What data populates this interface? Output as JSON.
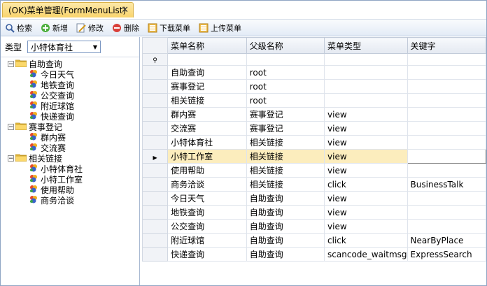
{
  "window": {
    "tab_title": "(OK)菜单管理(FormMenuList)",
    "close_glyph": "✕"
  },
  "toolbar": [
    {
      "label": "检索",
      "icon": "search-icon"
    },
    {
      "label": "新增",
      "icon": "add-icon"
    },
    {
      "label": "修改",
      "icon": "edit-icon"
    },
    {
      "label": "删除",
      "icon": "delete-icon"
    },
    {
      "label": "下载菜单",
      "icon": "download-menu-icon"
    },
    {
      "label": "上传菜单",
      "icon": "upload-menu-icon"
    }
  ],
  "filter": {
    "label": "类型",
    "selected": "小特体育社"
  },
  "tree": [
    {
      "label": "自助查询",
      "expanded": true,
      "children": [
        "今日天气",
        "地铁查询",
        "公交查询",
        "附近球馆",
        "快递查询"
      ]
    },
    {
      "label": "赛事登记",
      "expanded": true,
      "children": [
        "群内赛",
        "交流赛"
      ]
    },
    {
      "label": "相关链接",
      "expanded": true,
      "children": [
        "小特体育社",
        "小特工作室",
        "使用帮助",
        "商务洽谈"
      ]
    }
  ],
  "grid": {
    "columns": [
      "菜单名称",
      "父级名称",
      "菜单类型",
      "关键字"
    ],
    "selected_row": 6,
    "rows": [
      [
        "自助查询",
        "root",
        "",
        ""
      ],
      [
        "赛事登记",
        "root",
        "",
        ""
      ],
      [
        "相关链接",
        "root",
        "",
        ""
      ],
      [
        "群内赛",
        "赛事登记",
        "view",
        ""
      ],
      [
        "交流赛",
        "赛事登记",
        "view",
        ""
      ],
      [
        "小特体育社",
        "相关链接",
        "view",
        ""
      ],
      [
        "小特工作室",
        "相关链接",
        "view",
        ""
      ],
      [
        "使用帮助",
        "相关链接",
        "view",
        ""
      ],
      [
        "商务洽谈",
        "相关链接",
        "click",
        "BusinessTalk"
      ],
      [
        "今日天气",
        "自助查询",
        "view",
        ""
      ],
      [
        "地铁查询",
        "自助查询",
        "view",
        ""
      ],
      [
        "公交查询",
        "自助查询",
        "view",
        ""
      ],
      [
        "附近球馆",
        "自助查询",
        "click",
        "NearByPlace"
      ],
      [
        "快递查询",
        "自助查询",
        "scancode_waitmsg",
        "ExpressSearch"
      ]
    ]
  },
  "colors": {
    "selected_row": "#fcedbd",
    "tab_active": "#f9d46c",
    "header": "#e4e9f1"
  }
}
